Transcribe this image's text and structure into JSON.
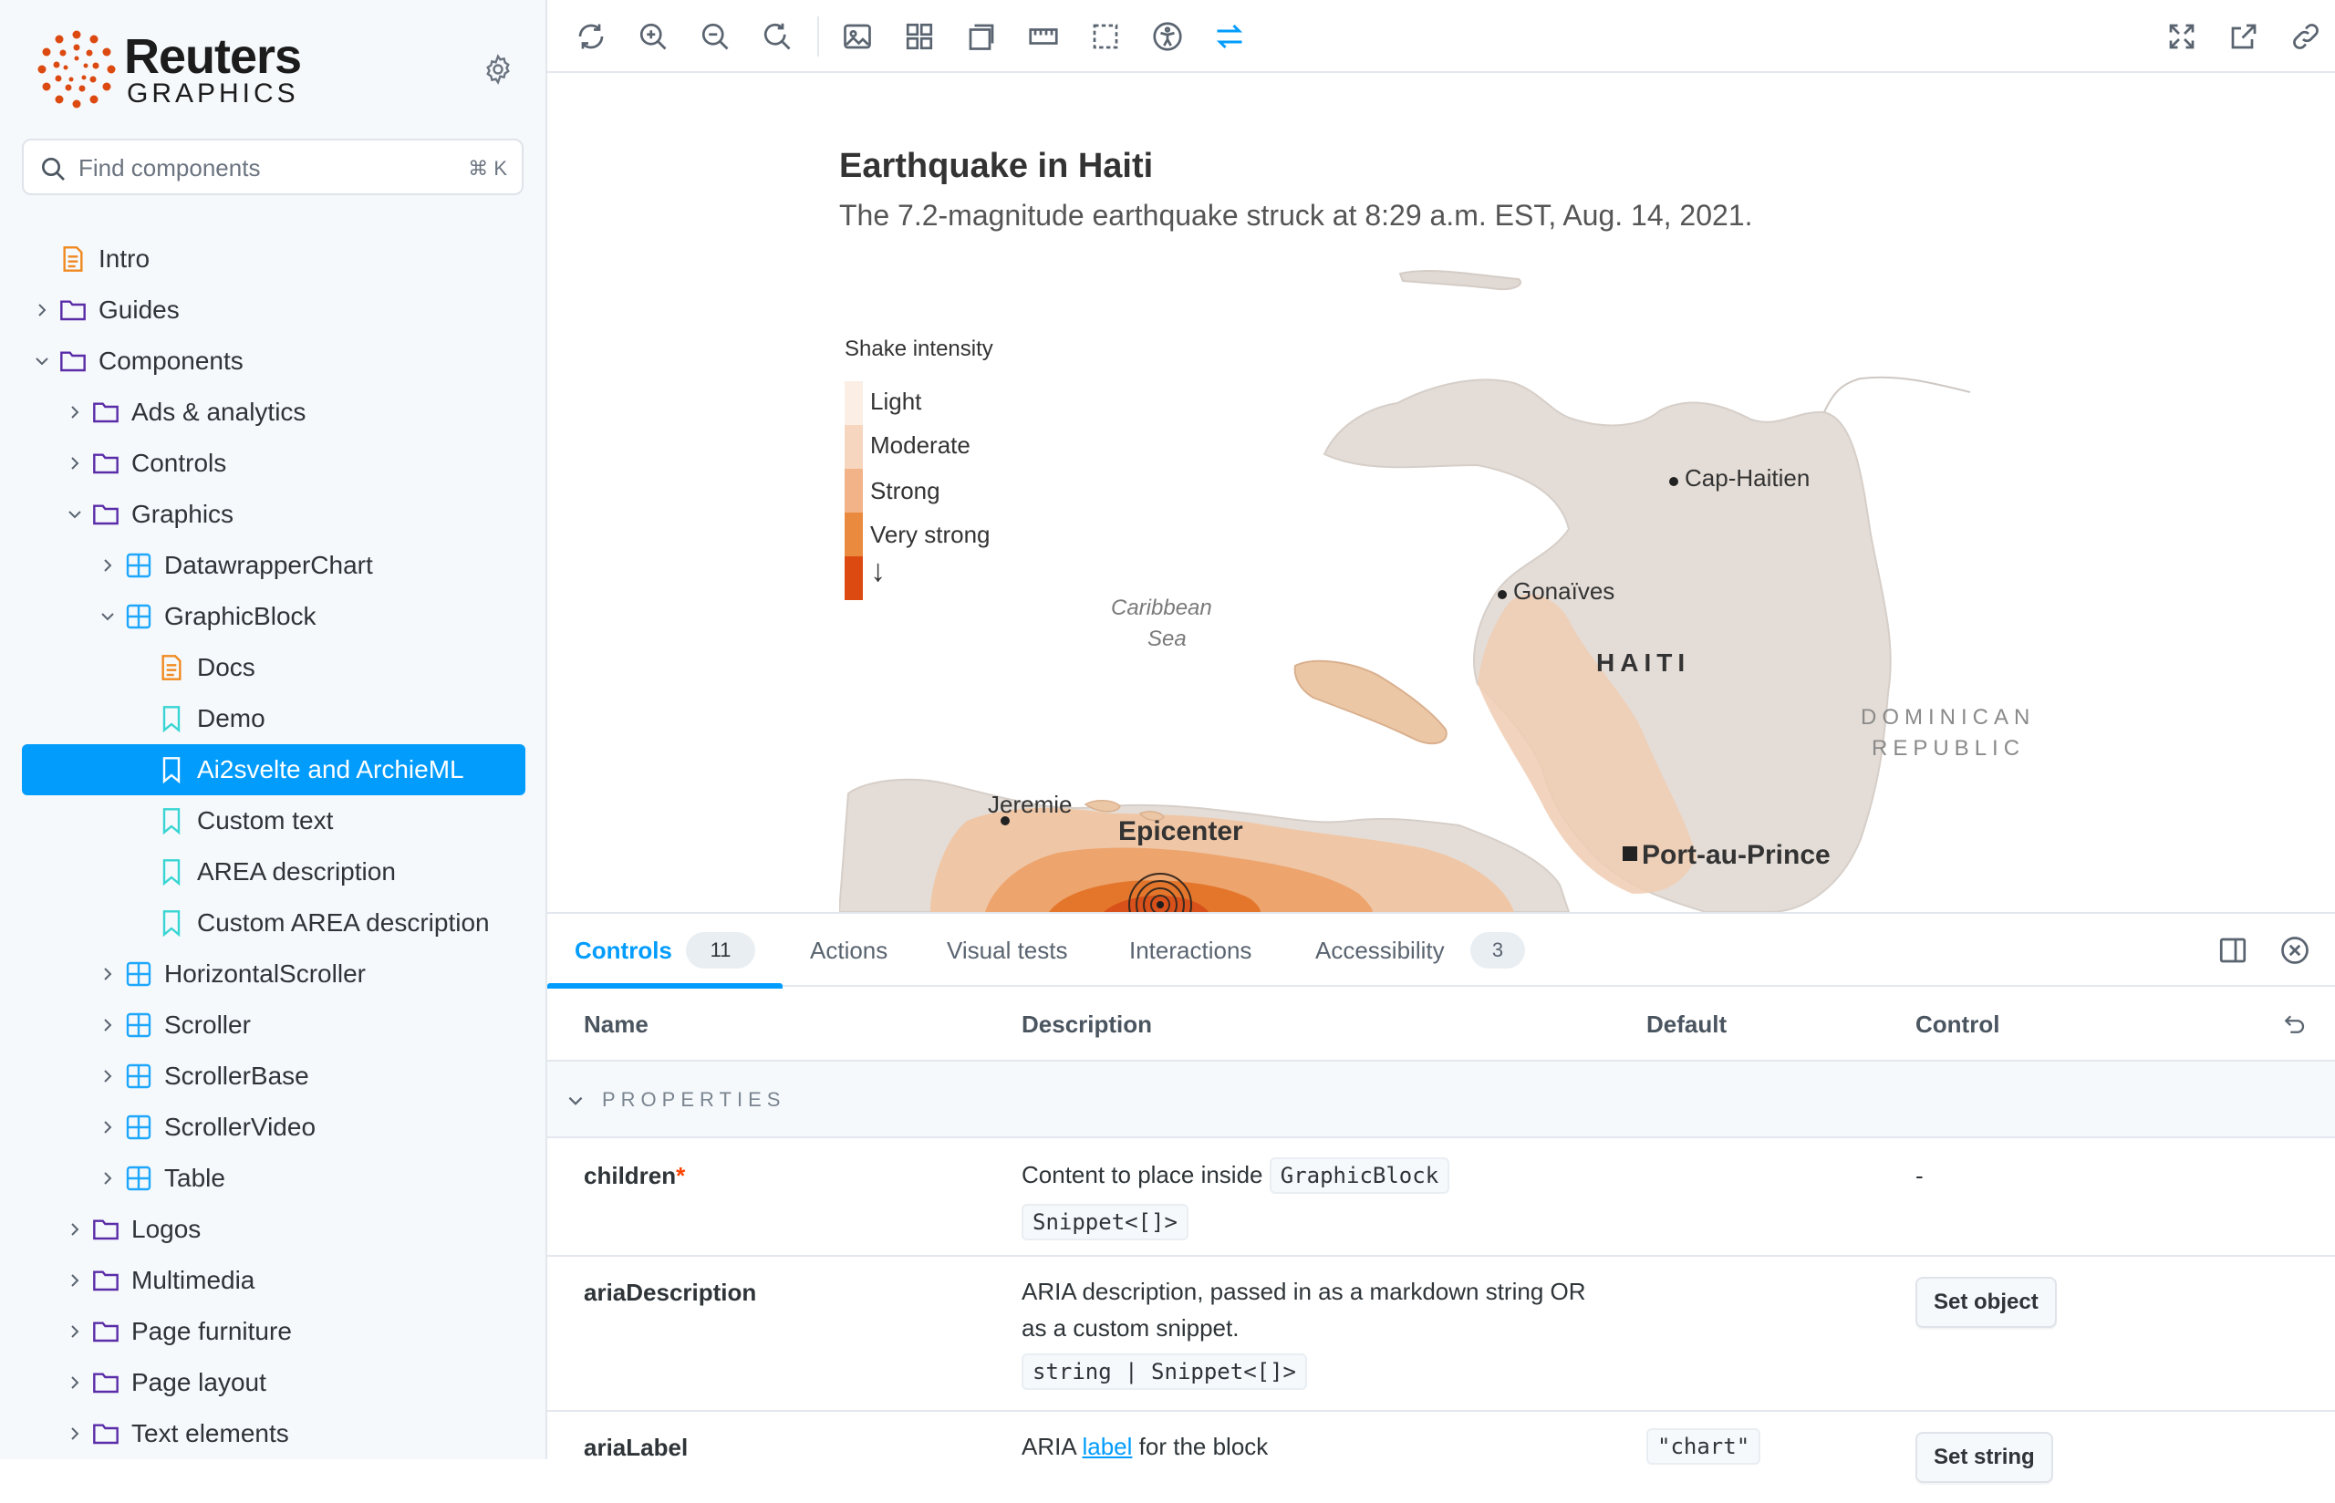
{
  "brand": {
    "name": "Reuters",
    "subtitle": "GRAPHICS"
  },
  "search": {
    "placeholder": "Find components",
    "shortcut": "⌘ K"
  },
  "tree": {
    "intro": "Intro",
    "guides": "Guides",
    "components": "Components",
    "ads": "Ads & analytics",
    "controls": "Controls",
    "graphics": "Graphics",
    "datawrapper": "DatawrapperChart",
    "graphicblock": "GraphicBlock",
    "docs": "Docs",
    "demo": "Demo",
    "ai2svelte": "Ai2svelte and ArchieML",
    "customtext": "Custom text",
    "area": "AREA description",
    "customarea": "Custom AREA description",
    "hscroller": "HorizontalScroller",
    "scroller": "Scroller",
    "scrollerbase": "ScrollerBase",
    "scrollervideo": "ScrollerVideo",
    "table": "Table",
    "logos": "Logos",
    "multimedia": "Multimedia",
    "pagefurniture": "Page furniture",
    "pagelayout": "Page layout",
    "textelements": "Text elements"
  },
  "graphic": {
    "title": "Earthquake in Haiti",
    "subtitle": "The 7.2-magnitude earthquake struck at 8:29 a.m. EST, Aug. 14, 2021.",
    "legend": {
      "title": "Shake intensity",
      "items": [
        "Light",
        "Moderate",
        "Strong",
        "Very strong"
      ],
      "arrow": "↓",
      "colors": [
        "#fbeee5",
        "#f7d6c0",
        "#f3b389",
        "#ea8a3e",
        "#dc4a12"
      ]
    },
    "labels": {
      "cap_haitien": "Cap-Haitien",
      "gonaives": "Gonaïves",
      "haiti": "HAITI",
      "dominican_1": "DOMINICAN",
      "dominican_2": "REPUBLIC",
      "sea_1": "Caribbean",
      "sea_2": "Sea",
      "jeremie": "Jeremie",
      "epicenter": "Epicenter",
      "port_au_prince": "Port-au-Prince"
    }
  },
  "panel": {
    "tabs": [
      {
        "label": "Controls",
        "badge": "11"
      },
      {
        "label": "Actions"
      },
      {
        "label": "Visual tests"
      },
      {
        "label": "Interactions"
      },
      {
        "label": "Accessibility",
        "badge": "3"
      }
    ],
    "columns": {
      "name": "Name",
      "description": "Description",
      "default": "Default",
      "control": "Control"
    },
    "section": "PROPERTIES",
    "rows": {
      "children": {
        "name": "children",
        "required": "*",
        "desc_prefix": "Content to place inside",
        "desc_code": "GraphicBlock",
        "type": "Snippet<[]>",
        "control": "-"
      },
      "ariaDescription": {
        "name": "ariaDescription",
        "desc": "ARIA description, passed in as a markdown string OR as a custom snippet.",
        "type": "string | Snippet<[]>",
        "control": "Set object"
      },
      "ariaLabel": {
        "name": "ariaLabel",
        "desc_prefix": "ARIA",
        "desc_link": "label",
        "desc_suffix": "for the block",
        "default": "\"chart\"",
        "control": "Set string"
      }
    }
  },
  "colors": {
    "accent": "#029cfd",
    "brand_orange": "#dc4a12",
    "required": "#ff4400"
  }
}
